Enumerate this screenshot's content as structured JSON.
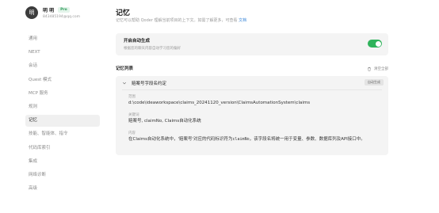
{
  "profile": {
    "avatar_letter": "明",
    "name": "明 明",
    "badge": "Pro",
    "email": "843485194@qq.com"
  },
  "nav": {
    "items": [
      {
        "label": "通用",
        "active": false
      },
      {
        "label": "NEXT",
        "active": false
      },
      {
        "label": "会话",
        "active": false
      },
      {
        "label": "Quest 模式",
        "active": false
      },
      {
        "label": "MCP 服务",
        "active": false
      },
      {
        "label": "规则",
        "active": false
      },
      {
        "label": "记忆",
        "active": true
      },
      {
        "label": "技能、智能体、指令",
        "active": false
      },
      {
        "label": "代码库索引",
        "active": false
      },
      {
        "label": "集成",
        "active": false
      },
      {
        "label": "网络诊断",
        "active": false
      },
      {
        "label": "高级",
        "active": false
      }
    ]
  },
  "main": {
    "title": "记忆",
    "description": "记忆可以帮助 Qoder 理解当前项目的上下文。如需了解更多，可查看",
    "description_link": "文档",
    "auto_generate": {
      "title": "开启自动生成",
      "description": "根据您的聊天内容自动学习您的偏好",
      "enabled": true
    },
    "list": {
      "title": "记忆列表",
      "clear_all": "清空全部"
    },
    "memory": {
      "title": "赔案号字段名约定",
      "badge": "自动生成",
      "scope_label": "范围",
      "scope_value": "d:\\code\\ideaworkspace\\claims_20241120_version\\ClaimsAutomationSystem\\claims",
      "keywords_label": "关键词",
      "keywords_value": "赔案号, claimNo, Claims自动化系统",
      "content_label": "内容",
      "content_prefix": "在Claims自动化系统中，'赔案号'对应的代码标识符为",
      "content_code": "claimNo",
      "content_suffix": "，该字段名将统一用于变量、参数、数据库列及API接口中。"
    }
  },
  "colors": {
    "accent_green": "#2fb35b",
    "link_blue": "#3a86d8",
    "card_bg": "#f4f4f4"
  }
}
